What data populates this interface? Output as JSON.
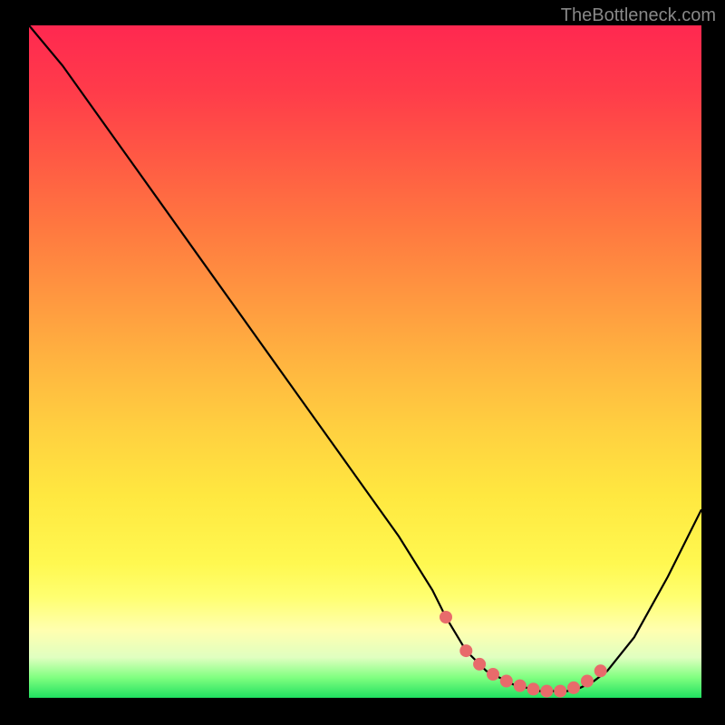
{
  "watermark": "TheBottleneck.com",
  "chart_data": {
    "type": "line",
    "title": "",
    "xlabel": "",
    "ylabel": "",
    "xlim": [
      0,
      100
    ],
    "ylim": [
      0,
      100
    ],
    "series": [
      {
        "name": "bottleneck-curve",
        "x": [
          0,
          5,
          10,
          15,
          20,
          25,
          30,
          35,
          40,
          45,
          50,
          55,
          60,
          62,
          65,
          68,
          72,
          76,
          80,
          82,
          84,
          86,
          90,
          95,
          100
        ],
        "y": [
          100,
          94,
          87,
          80,
          73,
          66,
          59,
          52,
          45,
          38,
          31,
          24,
          16,
          12,
          7,
          4,
          2,
          1,
          1,
          1.5,
          2.5,
          4,
          9,
          18,
          28
        ]
      }
    ],
    "markers": {
      "name": "optimal-range",
      "color": "#e86b6b",
      "x": [
        62,
        65,
        67,
        69,
        71,
        73,
        75,
        77,
        79,
        81,
        83,
        85
      ],
      "y": [
        12,
        7,
        5,
        3.5,
        2.5,
        1.8,
        1.3,
        1,
        1,
        1.5,
        2.5,
        4
      ]
    },
    "background": {
      "type": "vertical-gradient",
      "stops": [
        {
          "pos": 0,
          "color": "#ff2850"
        },
        {
          "pos": 50,
          "color": "#ffb440"
        },
        {
          "pos": 85,
          "color": "#ffff70"
        },
        {
          "pos": 100,
          "color": "#20e060"
        }
      ]
    }
  }
}
